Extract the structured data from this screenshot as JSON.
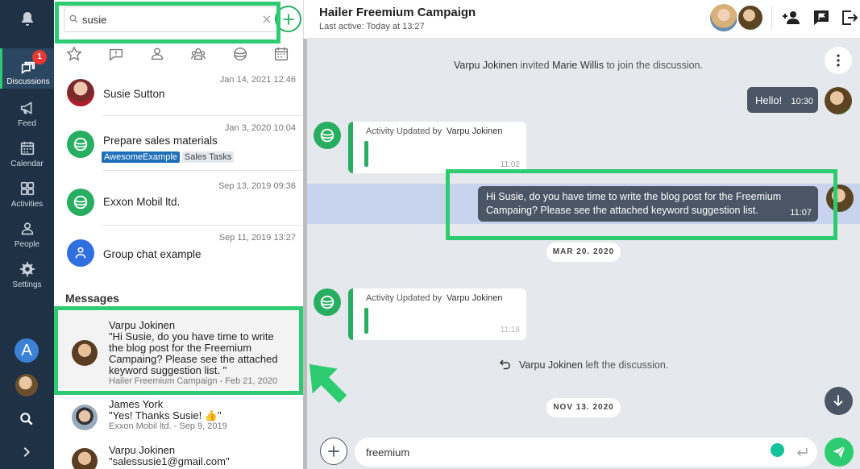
{
  "nav": {
    "discussions_label": "Discussions",
    "discussions_badge": "1",
    "feed_label": "Feed",
    "calendar_label": "Calendar",
    "activities_label": "Activities",
    "people_label": "People",
    "settings_label": "Settings",
    "account_letter": "A"
  },
  "search": {
    "value": "susie",
    "placeholder": ""
  },
  "conversations": [
    {
      "title": "Susie Sutton",
      "date": "Jan 14, 2021 12:46"
    },
    {
      "title": "Prepare sales materials",
      "date": "Jan 3, 2020 10:04",
      "tags": [
        "AwesomeExample",
        "Sales Tasks"
      ]
    },
    {
      "title": "Exxon Mobil ltd.",
      "date": "Sep 13, 2019 09:36"
    },
    {
      "title": "Group chat example",
      "date": "Sep 11, 2019 13:27"
    }
  ],
  "messages_section": "Messages",
  "message_results": [
    {
      "author": "Varpu Jokinen",
      "lines": [
        "\"Hi Susie, do you have time to write",
        "the blog post for the Freemium",
        "Campaing? Please see the attached",
        "keyword suggestion list. \""
      ],
      "meta": "Hailer Freemium Campaign - Feb 21, 2020"
    },
    {
      "author": "James York",
      "lines": [
        "\"Yes! Thanks Susie! 👍\""
      ],
      "meta": "Exxon Mobil ltd. - Sep 9, 2019"
    },
    {
      "author": "Varpu Jokinen",
      "lines": [
        "\"salessusie1@gmail.com\""
      ],
      "meta": ""
    }
  ],
  "chat": {
    "title": "Hailer Freemium Campaign",
    "subtitle": "Last active: Today at 13:27",
    "sys_invite": {
      "who": "Varpu Jokinen",
      "action": " invited ",
      "target": "Marie Willis",
      "tail": " to join the discussion."
    },
    "msg_hello": {
      "text": "Hello!",
      "time": "10:30"
    },
    "activity1": {
      "prefix": "Activity Updated by ",
      "who": "Varpu Jokinen",
      "time": "11:02"
    },
    "msg_long": {
      "line1": "Hi Susie, do you have time to write the blog post for the Freemium",
      "line2": "Campaing? Please see the attached keyword suggestion list.",
      "time": "11:07"
    },
    "date1": "MAR 20. 2020",
    "activity2": {
      "prefix": "Activity Updated by ",
      "who": "Varpu Jokinen",
      "time": "11:18"
    },
    "sys_left": {
      "who": "Varpu Jokinen",
      "tail": " left the discussion."
    },
    "date2": "NOV 13. 2020",
    "composer_value": "freemium"
  },
  "colors": {
    "nav_bg": "#1f3145",
    "accent_green": "#2ecc71",
    "bubble_dark": "#4a5666",
    "tag_blue": "#1e6fb8",
    "tag_grey": "#e4e9ef"
  }
}
